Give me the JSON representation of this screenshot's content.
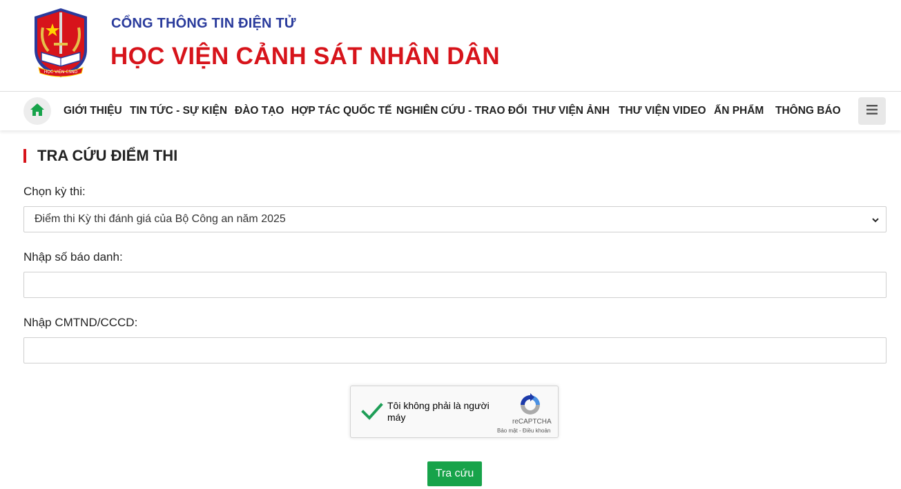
{
  "header": {
    "portal_title": "CỔNG THÔNG TIN ĐIỆN TỬ",
    "academy_title": "HỌC VIỆN CẢNH SÁT NHÂN DÂN",
    "logo_text": "HỌC VIỆN CSND",
    "logo_icon": "police-academy-emblem"
  },
  "nav": {
    "home_icon": "home-icon",
    "items": [
      {
        "label": "GIỚI THIỆU"
      },
      {
        "label": "TIN TỨC - SỰ KIỆN"
      },
      {
        "label": "ĐÀO TẠO"
      },
      {
        "label": "HỢP TÁC QUỐC TẾ"
      },
      {
        "label": "NGHIÊN CỨU - TRAO ĐỔI"
      },
      {
        "label": "THƯ VIỆN ẢNH"
      },
      {
        "label": "THƯ VIỆN VIDEO"
      },
      {
        "label": "ẤN PHẨM"
      },
      {
        "label": "THÔNG BÁO"
      }
    ],
    "menu_icon": "hamburger-menu-icon"
  },
  "main": {
    "title": "TRA CỨU ĐIỂM THI",
    "exam_label": "Chọn kỳ thi:",
    "exam_selected": "Điểm thi Kỳ thi đánh giá của Bộ Công an năm 2025",
    "candidate_label": "Nhập số báo danh:",
    "candidate_value": "",
    "id_label": "Nhập CMTND/CCCD:",
    "id_value": "",
    "submit_label": "Tra cứu"
  },
  "captcha": {
    "checked": true,
    "text": "Tôi không phải là người máy",
    "brand": "reCAPTCHA",
    "terms": "Bảo mật - Điều khoản"
  },
  "colors": {
    "brand_red": "#d7141b",
    "portal_blue": "#2a3b9c",
    "submit_green": "#17a34a",
    "home_green": "#17a34a"
  }
}
